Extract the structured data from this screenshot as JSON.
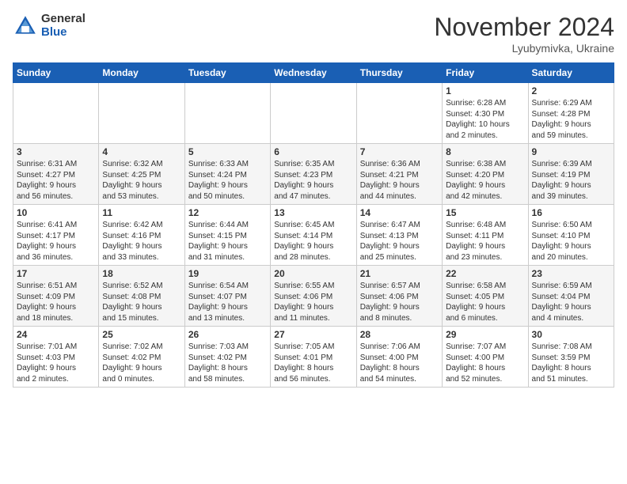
{
  "header": {
    "logo_general": "General",
    "logo_blue": "Blue",
    "month_title": "November 2024",
    "subtitle": "Lyubymivka, Ukraine"
  },
  "days_of_week": [
    "Sunday",
    "Monday",
    "Tuesday",
    "Wednesday",
    "Thursday",
    "Friday",
    "Saturday"
  ],
  "weeks": [
    {
      "days": [
        {
          "num": "",
          "info": ""
        },
        {
          "num": "",
          "info": ""
        },
        {
          "num": "",
          "info": ""
        },
        {
          "num": "",
          "info": ""
        },
        {
          "num": "",
          "info": ""
        },
        {
          "num": "1",
          "info": "Sunrise: 6:28 AM\nSunset: 4:30 PM\nDaylight: 10 hours\nand 2 minutes."
        },
        {
          "num": "2",
          "info": "Sunrise: 6:29 AM\nSunset: 4:28 PM\nDaylight: 9 hours\nand 59 minutes."
        }
      ]
    },
    {
      "days": [
        {
          "num": "3",
          "info": "Sunrise: 6:31 AM\nSunset: 4:27 PM\nDaylight: 9 hours\nand 56 minutes."
        },
        {
          "num": "4",
          "info": "Sunrise: 6:32 AM\nSunset: 4:25 PM\nDaylight: 9 hours\nand 53 minutes."
        },
        {
          "num": "5",
          "info": "Sunrise: 6:33 AM\nSunset: 4:24 PM\nDaylight: 9 hours\nand 50 minutes."
        },
        {
          "num": "6",
          "info": "Sunrise: 6:35 AM\nSunset: 4:23 PM\nDaylight: 9 hours\nand 47 minutes."
        },
        {
          "num": "7",
          "info": "Sunrise: 6:36 AM\nSunset: 4:21 PM\nDaylight: 9 hours\nand 44 minutes."
        },
        {
          "num": "8",
          "info": "Sunrise: 6:38 AM\nSunset: 4:20 PM\nDaylight: 9 hours\nand 42 minutes."
        },
        {
          "num": "9",
          "info": "Sunrise: 6:39 AM\nSunset: 4:19 PM\nDaylight: 9 hours\nand 39 minutes."
        }
      ]
    },
    {
      "days": [
        {
          "num": "10",
          "info": "Sunrise: 6:41 AM\nSunset: 4:17 PM\nDaylight: 9 hours\nand 36 minutes."
        },
        {
          "num": "11",
          "info": "Sunrise: 6:42 AM\nSunset: 4:16 PM\nDaylight: 9 hours\nand 33 minutes."
        },
        {
          "num": "12",
          "info": "Sunrise: 6:44 AM\nSunset: 4:15 PM\nDaylight: 9 hours\nand 31 minutes."
        },
        {
          "num": "13",
          "info": "Sunrise: 6:45 AM\nSunset: 4:14 PM\nDaylight: 9 hours\nand 28 minutes."
        },
        {
          "num": "14",
          "info": "Sunrise: 6:47 AM\nSunset: 4:13 PM\nDaylight: 9 hours\nand 25 minutes."
        },
        {
          "num": "15",
          "info": "Sunrise: 6:48 AM\nSunset: 4:11 PM\nDaylight: 9 hours\nand 23 minutes."
        },
        {
          "num": "16",
          "info": "Sunrise: 6:50 AM\nSunset: 4:10 PM\nDaylight: 9 hours\nand 20 minutes."
        }
      ]
    },
    {
      "days": [
        {
          "num": "17",
          "info": "Sunrise: 6:51 AM\nSunset: 4:09 PM\nDaylight: 9 hours\nand 18 minutes."
        },
        {
          "num": "18",
          "info": "Sunrise: 6:52 AM\nSunset: 4:08 PM\nDaylight: 9 hours\nand 15 minutes."
        },
        {
          "num": "19",
          "info": "Sunrise: 6:54 AM\nSunset: 4:07 PM\nDaylight: 9 hours\nand 13 minutes."
        },
        {
          "num": "20",
          "info": "Sunrise: 6:55 AM\nSunset: 4:06 PM\nDaylight: 9 hours\nand 11 minutes."
        },
        {
          "num": "21",
          "info": "Sunrise: 6:57 AM\nSunset: 4:06 PM\nDaylight: 9 hours\nand 8 minutes."
        },
        {
          "num": "22",
          "info": "Sunrise: 6:58 AM\nSunset: 4:05 PM\nDaylight: 9 hours\nand 6 minutes."
        },
        {
          "num": "23",
          "info": "Sunrise: 6:59 AM\nSunset: 4:04 PM\nDaylight: 9 hours\nand 4 minutes."
        }
      ]
    },
    {
      "days": [
        {
          "num": "24",
          "info": "Sunrise: 7:01 AM\nSunset: 4:03 PM\nDaylight: 9 hours\nand 2 minutes."
        },
        {
          "num": "25",
          "info": "Sunrise: 7:02 AM\nSunset: 4:02 PM\nDaylight: 9 hours\nand 0 minutes."
        },
        {
          "num": "26",
          "info": "Sunrise: 7:03 AM\nSunset: 4:02 PM\nDaylight: 8 hours\nand 58 minutes."
        },
        {
          "num": "27",
          "info": "Sunrise: 7:05 AM\nSunset: 4:01 PM\nDaylight: 8 hours\nand 56 minutes."
        },
        {
          "num": "28",
          "info": "Sunrise: 7:06 AM\nSunset: 4:00 PM\nDaylight: 8 hours\nand 54 minutes."
        },
        {
          "num": "29",
          "info": "Sunrise: 7:07 AM\nSunset: 4:00 PM\nDaylight: 8 hours\nand 52 minutes."
        },
        {
          "num": "30",
          "info": "Sunrise: 7:08 AM\nSunset: 3:59 PM\nDaylight: 8 hours\nand 51 minutes."
        }
      ]
    }
  ]
}
